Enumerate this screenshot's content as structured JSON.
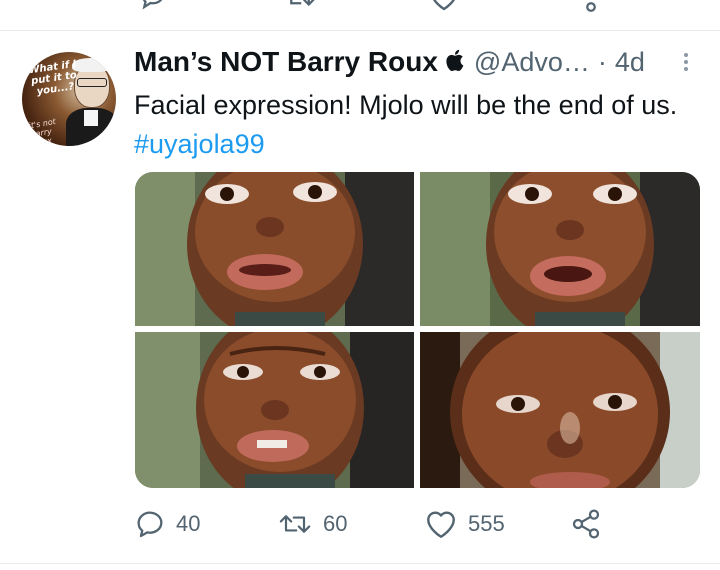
{
  "tweet": {
    "author_name": "Man’s NOT Barry Roux",
    "handle": "@Advo…",
    "separator": "·",
    "time": "4d",
    "text": "Facial expression! Mjolo will be the end of us.",
    "hashtag": "#uyajola99",
    "avatar_text": "What if I put it to you...?",
    "avatar_subtext": "it's not Barry Roux",
    "verified_badge_icon": "apple-icon",
    "stats": {
      "replies": "40",
      "retweets": "60",
      "likes": "555"
    },
    "media_count": 4
  },
  "colors": {
    "accent": "#1d9bf0",
    "secondary_text": "#536471",
    "primary_text": "#0f1419",
    "divider": "#e6ecf0"
  }
}
